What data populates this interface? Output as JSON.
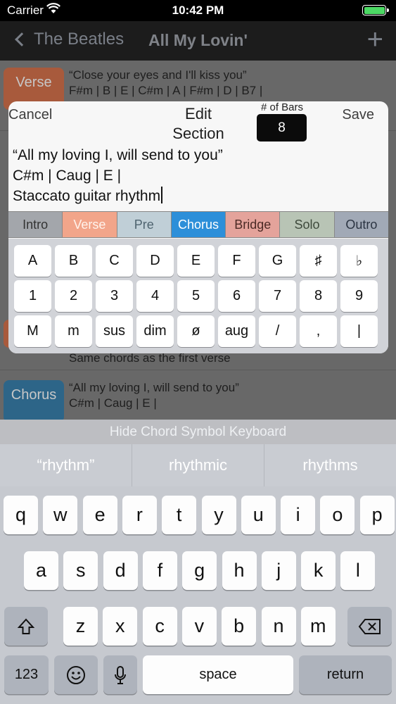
{
  "status": {
    "carrier": "Carrier",
    "time": "10:42 PM"
  },
  "nav": {
    "back_label": "The Beatles",
    "title": "All My Lovin'",
    "add_label": "+"
  },
  "background_list": [
    {
      "tag": "Verse",
      "lines": "“Close your eyes and I'll kiss you”\nF#m | B | E | C#m | A | F#m | D | B7 |",
      "color": "#c85a2c"
    },
    {
      "tag": "",
      "lines": "Same chords as the first verse",
      "color": "#c85a2c"
    },
    {
      "tag": "Chorus",
      "lines": "“All my loving I, will send to you”\nC#m | Caug | E |",
      "color": "#1f6b9a"
    }
  ],
  "panel": {
    "cancel_label": "Cancel",
    "title_line1": "Edit",
    "title_line2": "Section",
    "bars_label": "# of Bars",
    "bars_value": "8",
    "save_label": "Save",
    "text_lines": [
      "“All my loving I, will send to you”",
      "C#m | Caug | E |",
      "Staccato guitar rhythm"
    ],
    "section_types": [
      {
        "label": "Intro",
        "bg": "#a3a6ab",
        "fg": "#333333"
      },
      {
        "label": "Verse",
        "bg": "#f2a58a",
        "fg": "#fff3ec"
      },
      {
        "label": "Pre",
        "bg": "#c0cfd7",
        "fg": "#4f6470"
      },
      {
        "label": "Chorus",
        "bg": "#2d8fd9",
        "fg": "#ffffff"
      },
      {
        "label": "Bridge",
        "bg": "#e4a39b",
        "fg": "#4c2a25"
      },
      {
        "label": "Solo",
        "bg": "#b8c4b5",
        "fg": "#3e4a3c"
      },
      {
        "label": "Outro",
        "bg": "#a1a9b6",
        "fg": "#2b3442"
      }
    ],
    "chord_keys": [
      [
        "A",
        "B",
        "C",
        "D",
        "E",
        "F",
        "G",
        "♯",
        "♭"
      ],
      [
        "1",
        "2",
        "3",
        "4",
        "5",
        "6",
        "7",
        "8",
        "9"
      ],
      [
        "M",
        "m",
        "sus",
        "dim",
        "ø",
        "aug",
        "/",
        ",",
        "|"
      ]
    ]
  },
  "hide_keyboard_label": "Hide Chord Symbol Keyboard",
  "suggestions": [
    "“rhythm”",
    "rhythmic",
    "rhythms"
  ],
  "keyboard": {
    "row1": [
      "q",
      "w",
      "e",
      "r",
      "t",
      "y",
      "u",
      "i",
      "o",
      "p"
    ],
    "row2": [
      "a",
      "s",
      "d",
      "f",
      "g",
      "h",
      "j",
      "k",
      "l"
    ],
    "row3": [
      "z",
      "x",
      "c",
      "v",
      "b",
      "n",
      "m"
    ],
    "numbers_label": "123",
    "space_label": "space",
    "return_label": "return"
  }
}
